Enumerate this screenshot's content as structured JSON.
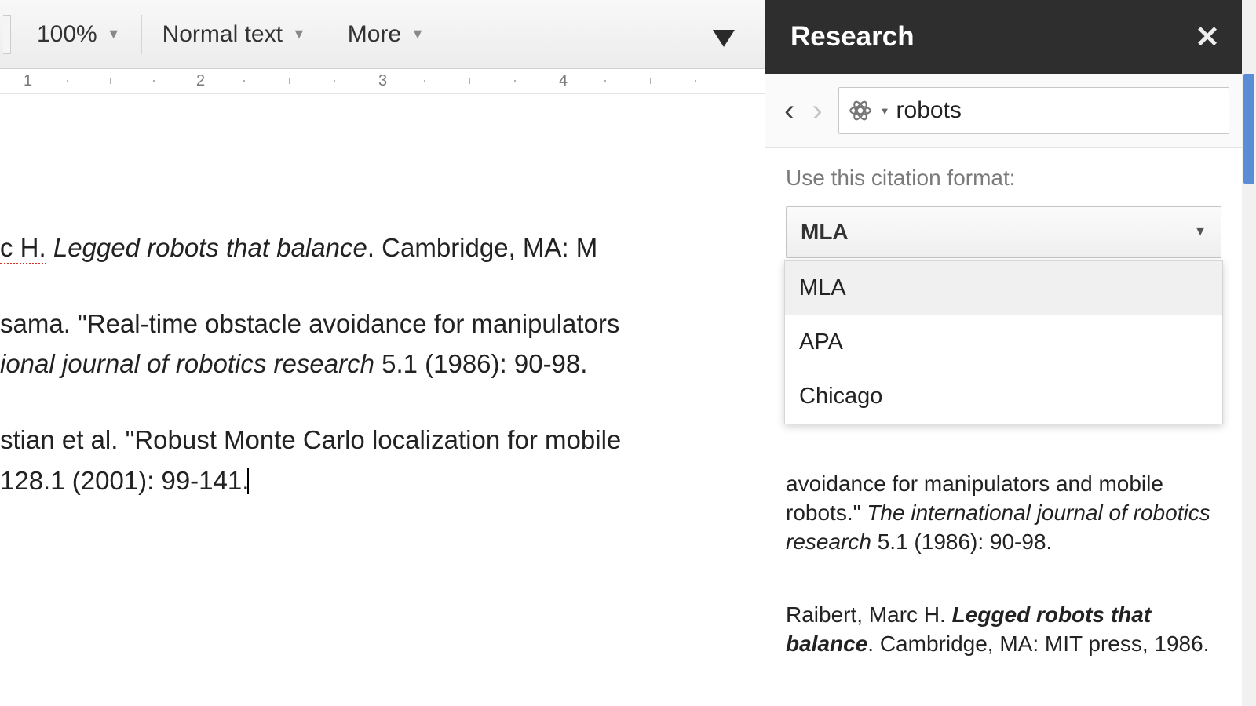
{
  "toolbar": {
    "zoom": "100%",
    "style": "Normal text",
    "more": "More"
  },
  "ruler": {
    "marks": [
      "1",
      "2",
      "3",
      "4"
    ]
  },
  "document": {
    "line1a": "c H.",
    "line1b": "Legged robots that balance",
    "line1c": ". Cambridge, MA: M",
    "line2a": "sama. \"Real-time obstacle avoidance for manipulators",
    "line2b": "ional journal of robotics research",
    "line2c": " 5.1 (1986): 90-98.",
    "line3a": "stian et al. \"Robust Monte Carlo localization for mobile",
    "line3b": " 128.1 (2001): 99-141."
  },
  "research": {
    "title": "Research",
    "search_value": "robots",
    "citation_label": "Use this citation format:",
    "selected_format": "MLA",
    "options": [
      "MLA",
      "APA",
      "Chicago"
    ],
    "result1_a": "avoidance for manipulators and mobile robots.\" ",
    "result1_b": "The international journal of robotics research",
    "result1_c": " 5.1 (1986): 90-98.",
    "result2_a": "Raibert, Marc H. ",
    "result2_b": "Legged robots that balance",
    "result2_c": ". Cambridge, MA: MIT press, 1986."
  }
}
